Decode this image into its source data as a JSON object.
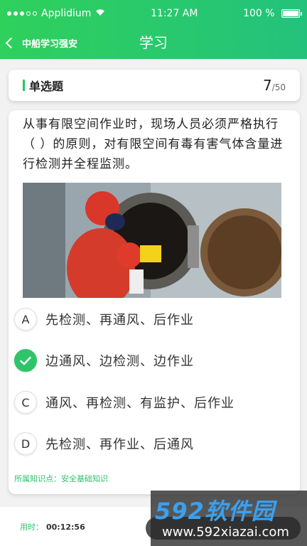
{
  "status": {
    "carrier": "Applidium",
    "time": "11:27 AM",
    "battery": "100 %"
  },
  "nav": {
    "back_label": "中船学习强安",
    "title": "学习"
  },
  "question": {
    "type": "单选题",
    "current": "7",
    "total": "/50",
    "text": "从事有限空间作业时，现场人员必须严格执行（    ）的原则，对有限空间有毒有害气体含量进行检测并全程监测。",
    "options": [
      {
        "letter": "A",
        "label": "先检测、再通风、后作业",
        "selected": false
      },
      {
        "letter": "B",
        "label": "边通风、边检测、边作业",
        "selected": true
      },
      {
        "letter": "C",
        "label": "通风、再检测、有监护、后作业",
        "selected": false
      },
      {
        "letter": "D",
        "label": "先检测、再作业、后通风",
        "selected": false
      }
    ],
    "knowledge_point_label": "所属知识点：",
    "knowledge_point": "安全基础知识"
  },
  "footer": {
    "timer_label": "用时：",
    "timer_value": "00:12:56"
  },
  "watermark": {
    "brand": "592软件园",
    "url": "www.592xiazai.com"
  },
  "colors": {
    "accent": "#2ec46a",
    "header_gradient_start": "#2fd05c",
    "header_gradient_end": "#23c27c"
  }
}
